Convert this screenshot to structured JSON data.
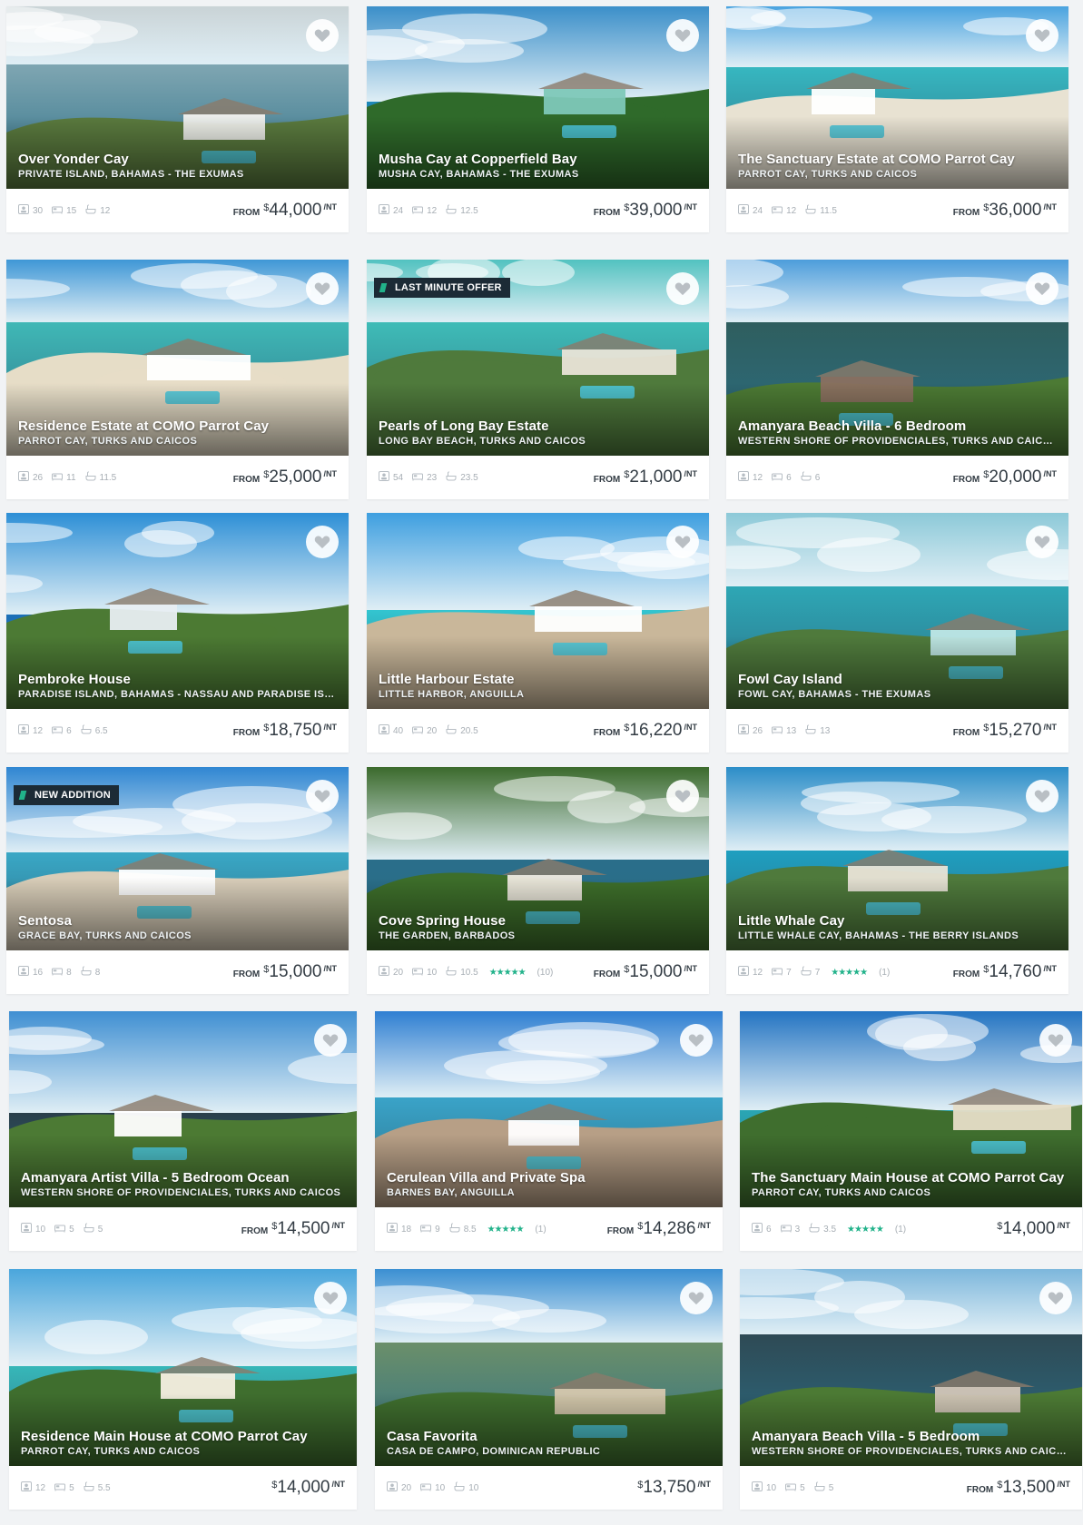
{
  "listings": [
    {
      "name": "Over Yonder Cay",
      "location": "PRIVATE ISLAND, BAHAMAS - THE EXUMAS",
      "guests": "30",
      "bedrooms": "15",
      "baths": "12",
      "from": "FROM",
      "currency": "$",
      "amount": "44,000",
      "unit": "/NT",
      "badge": "",
      "stars": "",
      "reviews": "",
      "palette": {
        "sky": "#c9d3d6",
        "sea": "#7fa6b2",
        "land": "#5a7a3e",
        "accent": "#f2f2ee"
      }
    },
    {
      "name": "Musha Cay at Copperfield Bay",
      "location": "MUSHA CAY, BAHAMAS - THE EXUMAS",
      "guests": "24",
      "bedrooms": "12",
      "baths": "12.5",
      "from": "FROM",
      "currency": "$",
      "amount": "39,000",
      "unit": "/NT",
      "badge": "",
      "stars": "",
      "reviews": "",
      "palette": {
        "sky": "#3b8fc9",
        "sea": "#1e88b8",
        "land": "#2f6a2a",
        "accent": "#7ec8b8"
      }
    },
    {
      "name": "The Sanctuary Estate at COMO Parrot Cay",
      "location": "PARROT CAY, TURKS AND CAICOS",
      "guests": "24",
      "bedrooms": "12",
      "baths": "11.5",
      "from": "FROM",
      "currency": "$",
      "amount": "36,000",
      "unit": "/NT",
      "badge": "",
      "stars": "",
      "reviews": "",
      "palette": {
        "sky": "#4aa3df",
        "sea": "#37b7c0",
        "land": "#e8e2d2",
        "accent": "#ffffff"
      }
    },
    {
      "name": "Residence Estate at COMO Parrot Cay",
      "location": "PARROT CAY, TURKS AND CAICOS",
      "guests": "26",
      "bedrooms": "11",
      "baths": "11.5",
      "from": "FROM",
      "currency": "$",
      "amount": "25,000",
      "unit": "/NT",
      "badge": "",
      "stars": "",
      "reviews": "",
      "palette": {
        "sky": "#3f97d6",
        "sea": "#40b8b6",
        "land": "#e6ddc7",
        "accent": "#ffffff"
      }
    },
    {
      "name": "Pearls of Long Bay Estate",
      "location": "LONG BAY BEACH, TURKS AND CAICOS",
      "guests": "54",
      "bedrooms": "23",
      "baths": "23.5",
      "from": "FROM",
      "currency": "$",
      "amount": "21,000",
      "unit": "/NT",
      "badge": "LAST MINUTE OFFER",
      "stars": "",
      "reviews": "",
      "palette": {
        "sky": "#52c2c0",
        "sea": "#3fbcb7",
        "land": "#4f7a3c",
        "accent": "#e9e4d7"
      }
    },
    {
      "name": "Amanyara Beach Villa - 6 Bedroom",
      "location": "WESTERN SHORE OF PROVIDENCIALES, TURKS AND CAICOS",
      "guests": "12",
      "bedrooms": "6",
      "baths": "6",
      "from": "FROM",
      "currency": "$",
      "amount": "20,000",
      "unit": "/NT",
      "badge": "",
      "stars": "",
      "reviews": "",
      "palette": {
        "sky": "#4d9ddb",
        "sea": "#2f5e5e",
        "land": "#4c7a34",
        "accent": "#8a7060"
      }
    },
    {
      "name": "Pembroke House",
      "location": "PARADISE ISLAND, BAHAMAS - NASSAU AND PARADISE ISLAND",
      "guests": "12",
      "bedrooms": "6",
      "baths": "6.5",
      "from": "FROM",
      "currency": "$",
      "amount": "18,750",
      "unit": "/NT",
      "badge": "",
      "stars": "",
      "reviews": "",
      "palette": {
        "sky": "#2d8fd6",
        "sea": "#1c6fb8",
        "land": "#4c7a34",
        "accent": "#e8eef2"
      }
    },
    {
      "name": "Little Harbour Estate",
      "location": "LITTLE HARBOR, ANGUILLA",
      "guests": "40",
      "bedrooms": "20",
      "baths": "20.5",
      "from": "FROM",
      "currency": "$",
      "amount": "16,220",
      "unit": "/NT",
      "badge": "",
      "stars": "",
      "reviews": "",
      "palette": {
        "sky": "#3e9fe0",
        "sea": "#33c5d0",
        "land": "#c9b79a",
        "accent": "#ffffff"
      }
    },
    {
      "name": "Fowl Cay Island",
      "location": "FOWL CAY, BAHAMAS - THE EXUMAS",
      "guests": "26",
      "bedrooms": "13",
      "baths": "13",
      "from": "FROM",
      "currency": "$",
      "amount": "15,270",
      "unit": "/NT",
      "badge": "",
      "stars": "",
      "reviews": "",
      "palette": {
        "sky": "#8cc9d8",
        "sea": "#2ea7b5",
        "land": "#4f7a3c",
        "accent": "#bfe7e6"
      }
    },
    {
      "name": "Sentosa",
      "location": "GRACE BAY, TURKS AND CAICOS",
      "guests": "16",
      "bedrooms": "8",
      "baths": "8",
      "from": "FROM",
      "currency": "$",
      "amount": "15,000",
      "unit": "/NT",
      "badge": "NEW ADDITION",
      "stars": "",
      "reviews": "",
      "palette": {
        "sky": "#2f86d2",
        "sea": "#3aa8c6",
        "land": "#d8cdb8",
        "accent": "#ffffff"
      }
    },
    {
      "name": "Cove Spring House",
      "location": "THE GARDEN, BARBADOS",
      "guests": "20",
      "bedrooms": "10",
      "baths": "10.5",
      "from": "FROM",
      "currency": "$",
      "amount": "15,000",
      "unit": "/NT",
      "badge": "",
      "stars": "★★★★★",
      "reviews": "(10)",
      "palette": {
        "sky": "#3b6a2c",
        "sea": "#2a6e8a",
        "land": "#3d6e2a",
        "accent": "#efe9df"
      }
    },
    {
      "name": "Little Whale Cay",
      "location": "LITTLE WHALE CAY, BAHAMAS - THE BERRY ISLANDS",
      "guests": "12",
      "bedrooms": "7",
      "baths": "7",
      "from": "FROM",
      "currency": "$",
      "amount": "14,760",
      "unit": "/NT",
      "badge": "",
      "stars": "★★★★★",
      "reviews": "(1)",
      "palette": {
        "sky": "#2b8dc8",
        "sea": "#1f9fc0",
        "land": "#4f7a3c",
        "accent": "#e9e4d7"
      }
    },
    {
      "name": "Amanyara Artist Villa - 5 Bedroom Ocean",
      "location": "WESTERN SHORE OF PROVIDENCIALES, TURKS AND CAICOS",
      "guests": "10",
      "bedrooms": "5",
      "baths": "5",
      "from": "FROM",
      "currency": "$",
      "amount": "14,500",
      "unit": "/NT",
      "badge": "",
      "stars": "",
      "reviews": "",
      "palette": {
        "sky": "#3f8fd2",
        "sea": "#2a3f4a",
        "land": "#4c7a34",
        "accent": "#ffffff"
      }
    },
    {
      "name": "Cerulean Villa and Private Spa",
      "location": "BARNES BAY, ANGUILLA",
      "guests": "18",
      "bedrooms": "9",
      "baths": "8.5",
      "from": "FROM",
      "currency": "$",
      "amount": "14,286",
      "unit": "/NT",
      "badge": "",
      "stars": "★★★★★",
      "reviews": "(1)",
      "palette": {
        "sky": "#2f7fd2",
        "sea": "#3aa3c8",
        "land": "#b79f86",
        "accent": "#ffffff"
      }
    },
    {
      "name": "The Sanctuary Main House at COMO Parrot Cay",
      "location": "PARROT CAY, TURKS AND CAICOS",
      "guests": "6",
      "bedrooms": "3",
      "baths": "3.5",
      "from": "",
      "currency": "$",
      "amount": "14,000",
      "unit": "/NT",
      "badge": "",
      "stars": "★★★★★",
      "reviews": "(1)",
      "palette": {
        "sky": "#2474c2",
        "sea": "#2aa6b4",
        "land": "#3f6e2e",
        "accent": "#e6ddc7"
      }
    },
    {
      "name": "Residence Main House at COMO Parrot Cay",
      "location": "PARROT CAY, TURKS AND CAICOS",
      "guests": "12",
      "bedrooms": "5",
      "baths": "5.5",
      "from": "",
      "currency": "$",
      "amount": "14,000",
      "unit": "/NT",
      "badge": "",
      "stars": "",
      "reviews": "",
      "palette": {
        "sky": "#4aa6dc",
        "sea": "#37b7b8",
        "land": "#3f6e2e",
        "accent": "#f5efe2"
      }
    },
    {
      "name": "Casa Favorita",
      "location": "CASA DE CAMPO, DOMINICAN REPUBLIC",
      "guests": "20",
      "bedrooms": "10",
      "baths": "10",
      "from": "",
      "currency": "$",
      "amount": "13,750",
      "unit": "/NT",
      "badge": "",
      "stars": "",
      "reviews": "",
      "palette": {
        "sky": "#3b8fd2",
        "sea": "#6b8f6a",
        "land": "#3f6e2e",
        "accent": "#d6c7ae"
      }
    },
    {
      "name": "Amanyara Beach Villa - 5 Bedroom",
      "location": "WESTERN SHORE OF PROVIDENCIALES, TURKS AND CAICOS",
      "guests": "10",
      "bedrooms": "5",
      "baths": "5",
      "from": "FROM",
      "currency": "$",
      "amount": "13,500",
      "unit": "/NT",
      "badge": "",
      "stars": "",
      "reviews": "",
      "palette": {
        "sky": "#7db7dc",
        "sea": "#2e4a55",
        "land": "#4c7a34",
        "accent": "#d2c6b8"
      }
    }
  ],
  "icons": {
    "favorite": "heart-icon",
    "guests": "guests-icon",
    "bedrooms": "bed-icon",
    "baths": "bath-icon",
    "badge": "tag-icon"
  },
  "colors": {
    "accent_green": "#21b28a",
    "badge_bg": "#1c2b36",
    "page_bg": "#f1f3f5"
  }
}
